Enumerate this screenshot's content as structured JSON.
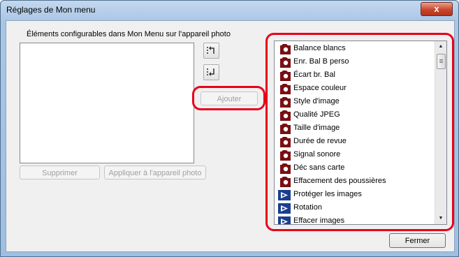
{
  "window": {
    "title": "Réglages de Mon menu",
    "close_glyph": "x"
  },
  "dialog": {
    "section_label": "Éléments configurables dans Mon Menu sur l'appareil photo",
    "ajouter_label": "Ajouter",
    "supprimer_label": "Supprimer",
    "appliquer_label": "Appliquer à l'appareil photo",
    "fermer_label": "Fermer",
    "icon_buttons": [
      "move-up-icon",
      "move-down-icon"
    ]
  },
  "items_list": {
    "items": [
      {
        "label": "Balance blancs",
        "icon": "shooting-menu-icon"
      },
      {
        "label": "Enr. Bal B perso",
        "icon": "shooting-menu-icon"
      },
      {
        "label": "Écart br. Bal",
        "icon": "shooting-menu-icon"
      },
      {
        "label": "Espace couleur",
        "icon": "shooting-menu-icon"
      },
      {
        "label": "Style d'image",
        "icon": "shooting-menu-icon"
      },
      {
        "label": "Qualité JPEG",
        "icon": "shooting-menu-icon"
      },
      {
        "label": "Taille d'image",
        "icon": "shooting-menu-icon"
      },
      {
        "label": "Durée de revue",
        "icon": "shooting-menu-icon"
      },
      {
        "label": "Signal sonore",
        "icon": "shooting-menu-icon"
      },
      {
        "label": "Déc sans carte",
        "icon": "shooting-menu-icon"
      },
      {
        "label": "Effacement des poussières",
        "icon": "shooting-menu-icon"
      },
      {
        "label": "Protéger les images",
        "icon": "playback-menu-icon"
      },
      {
        "label": "Rotation",
        "icon": "playback-menu-icon"
      },
      {
        "label": "Effacer images",
        "icon": "playback-menu-icon"
      }
    ]
  },
  "colors": {
    "highlight": "#e8001a",
    "shooting_icon": "#7a0f12",
    "playback_icon": "#1b3f8f"
  }
}
